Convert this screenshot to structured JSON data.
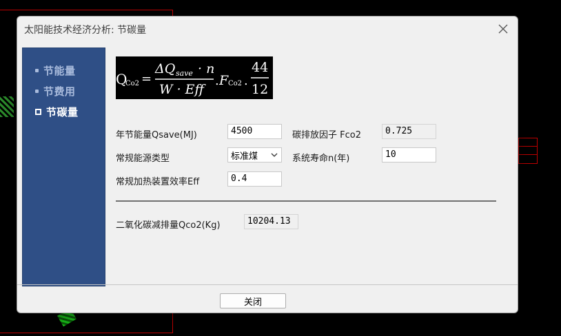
{
  "window": {
    "title": "太阳能技术经济分析: 节碳量"
  },
  "sidebar": {
    "items": [
      {
        "label": "节能量",
        "active": false
      },
      {
        "label": "节费用",
        "active": false
      },
      {
        "label": "节碳量",
        "active": true
      }
    ]
  },
  "formula": {
    "lhs_main": "Q",
    "lhs_sub": "Co2",
    "equals": "=",
    "numerator": "ΔQ",
    "numerator_sub": "save",
    "numerator_tail": "· n",
    "denominator": "W · Eff",
    "dot1": ".",
    "factor_main": "F",
    "factor_sub": "Co2",
    "dot2": ".",
    "ratio_num": "44",
    "ratio_den": "12"
  },
  "form": {
    "annual_saving_label": "年节能量Qsave(MJ)",
    "annual_saving_value": "4500",
    "carbon_factor_label": "碳排放因子 Fco2",
    "carbon_factor_value": "0.725",
    "energy_type_label": "常规能源类型",
    "energy_type_value": "标准煤",
    "lifetime_label": "系统寿命n(年)",
    "lifetime_value": "10",
    "efficiency_label": "常规加热装置效率Eff",
    "efficiency_value": "0.4",
    "co2_reduction_label": "二氧化碳减排量Qco2(Kg)",
    "co2_reduction_value": "10204.13"
  },
  "buttons": {
    "close_label": "关闭"
  },
  "icons": {
    "close": "close-icon",
    "dropdown": "chevron-down-icon",
    "bullet": "square-bullet-icon"
  },
  "colors": {
    "sidebar_bg": "#2f4f86",
    "active_nav": "#ffffff",
    "inactive_nav": "#a9bbdc",
    "formula_bg": "#000000"
  }
}
